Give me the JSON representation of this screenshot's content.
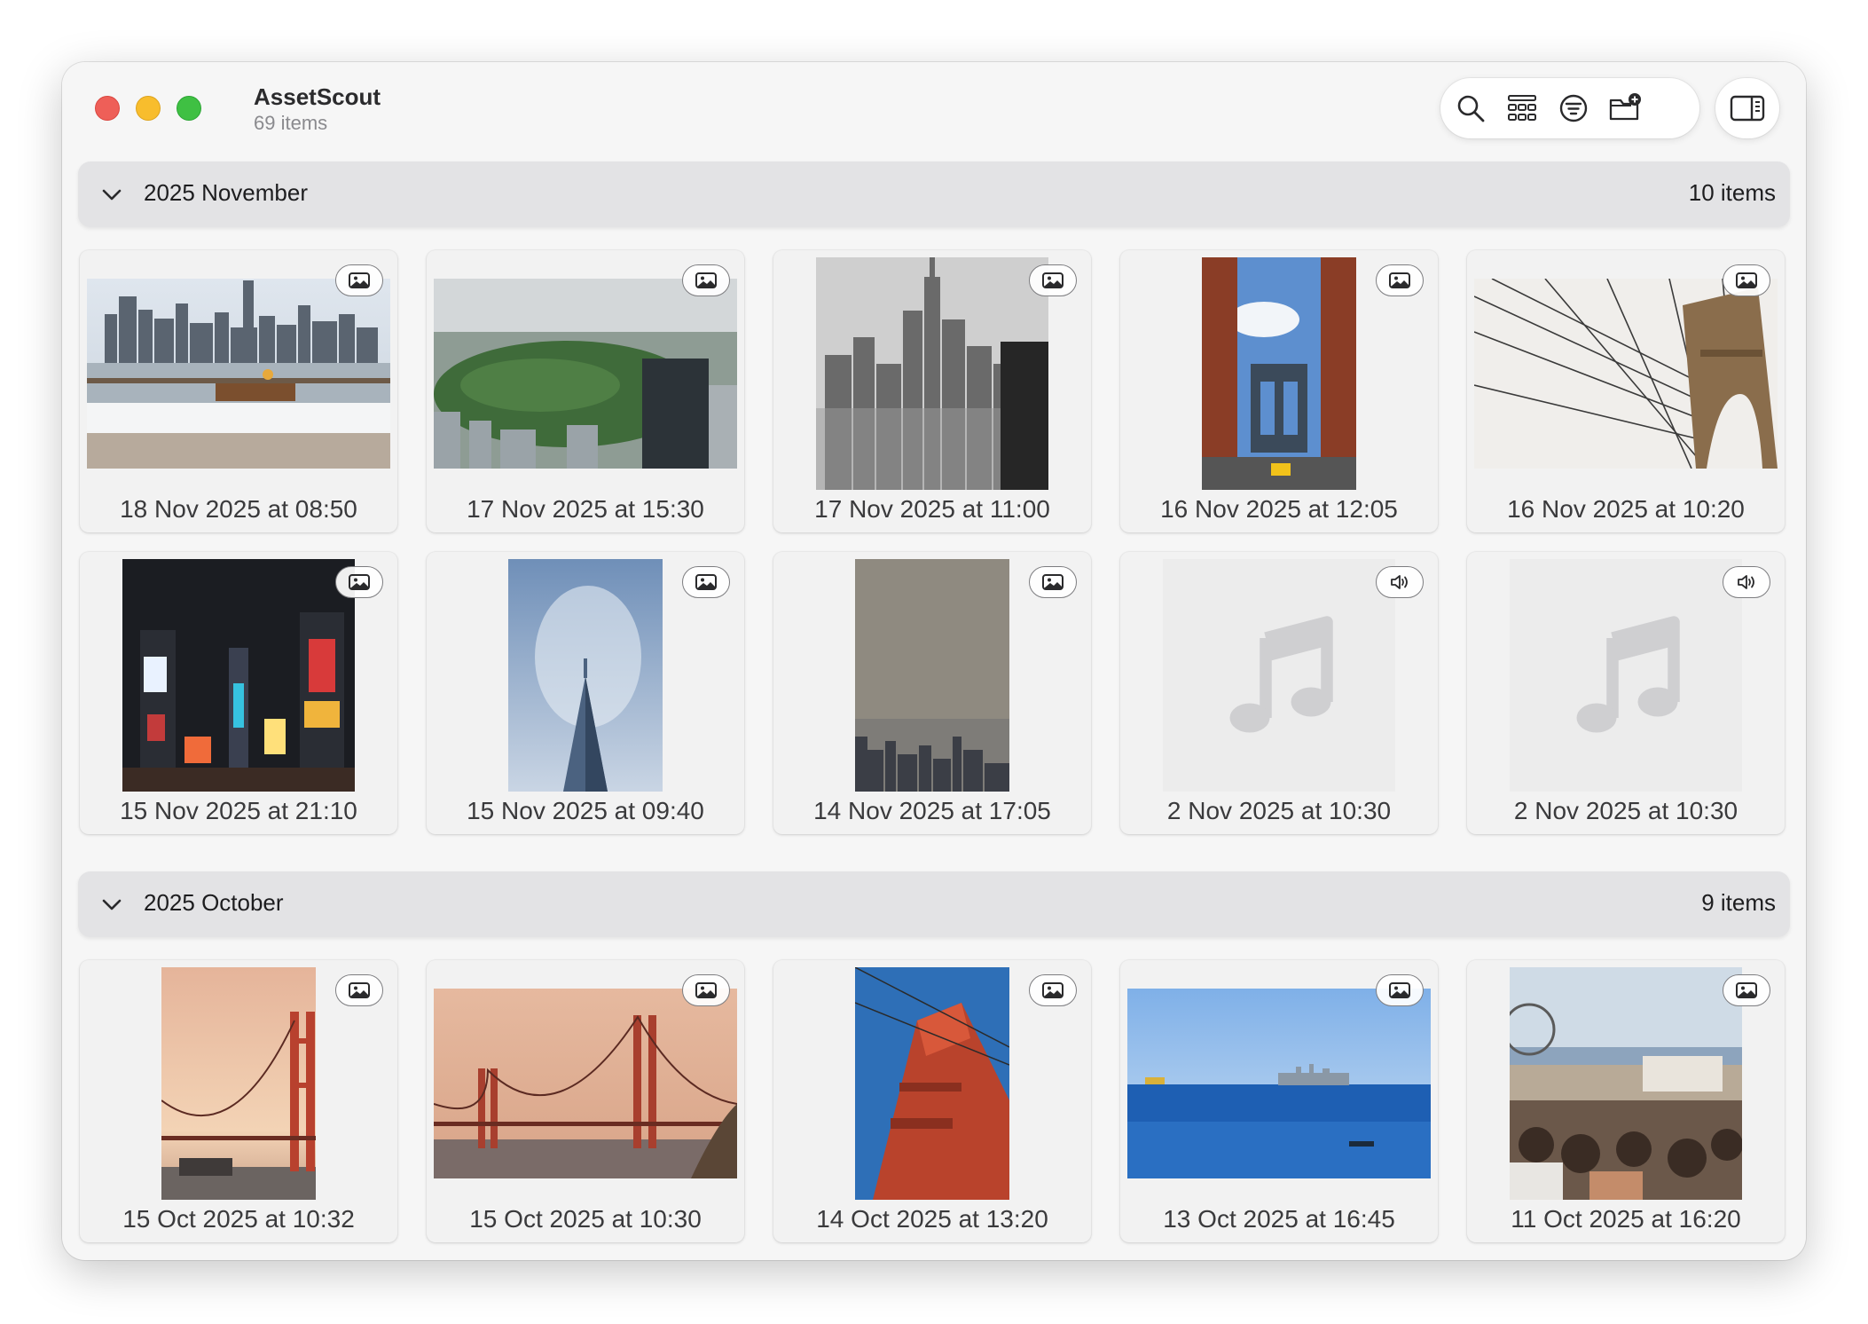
{
  "app": {
    "title": "AssetScout",
    "subtitle": "69 items"
  },
  "toolbar": {
    "icons": [
      "search-icon",
      "grid-view-icon",
      "filter-icon",
      "new-folder-icon",
      "sidebar-toggle-icon"
    ]
  },
  "colors": {
    "window_bg": "#f6f6f6",
    "section_header_bg": "#e3e3e5",
    "card_bg": "#f2f2f2",
    "traffic_red": "#ee5f58",
    "traffic_yellow": "#f8bd2d",
    "traffic_green": "#3fc043"
  },
  "sections": [
    {
      "title": "2025 November",
      "count": "10 items",
      "items": [
        {
          "caption": "18 Nov 2025 at 08:50",
          "type": "image",
          "badge_icon": "photo-icon"
        },
        {
          "caption": "17 Nov 2025 at 15:30",
          "type": "image",
          "badge_icon": "photo-icon"
        },
        {
          "caption": "17 Nov 2025 at 11:00",
          "type": "image",
          "badge_icon": "photo-icon"
        },
        {
          "caption": "16 Nov 2025 at 12:05",
          "type": "image",
          "badge_icon": "photo-icon"
        },
        {
          "caption": "16 Nov 2025 at 10:20",
          "type": "image",
          "badge_icon": "photo-icon"
        },
        {
          "caption": "15 Nov 2025 at 21:10",
          "type": "image",
          "badge_icon": "photo-icon"
        },
        {
          "caption": "15 Nov 2025 at 09:40",
          "type": "image",
          "badge_icon": "photo-icon"
        },
        {
          "caption": "14 Nov 2025 at 17:05",
          "type": "image",
          "badge_icon": "photo-icon"
        },
        {
          "caption": "2 Nov 2025 at 10:30",
          "type": "audio",
          "badge_icon": "speaker-icon"
        },
        {
          "caption": "2 Nov 2025 at 10:30",
          "type": "audio",
          "badge_icon": "speaker-icon"
        }
      ]
    },
    {
      "title": "2025 October",
      "count": "9 items",
      "items": [
        {
          "caption": "15 Oct 2025 at 10:32",
          "type": "image",
          "badge_icon": "photo-icon"
        },
        {
          "caption": "15 Oct 2025 at 10:30",
          "type": "image",
          "badge_icon": "photo-icon"
        },
        {
          "caption": "14 Oct 2025 at 13:20",
          "type": "image",
          "badge_icon": "photo-icon"
        },
        {
          "caption": "13 Oct 2025 at 16:45",
          "type": "image",
          "badge_icon": "photo-icon"
        },
        {
          "caption": "11 Oct 2025 at 16:20",
          "type": "image",
          "badge_icon": "photo-icon"
        }
      ]
    }
  ]
}
